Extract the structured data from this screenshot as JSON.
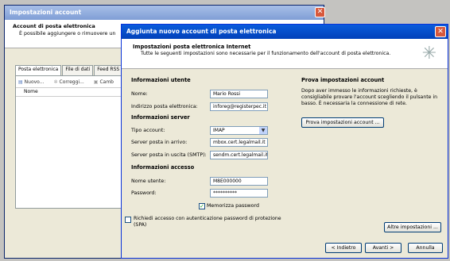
{
  "back_window": {
    "title": "Impostazioni account",
    "header_title": "Account di posta elettronica",
    "header_subtitle": "È possibile aggiungere o rimuovere un",
    "tabs": [
      "Posta elettronica",
      "File di dati",
      "Feed RSS"
    ],
    "toolbar": {
      "new": "Nuovo...",
      "repair": "Correggi...",
      "change": "Camb"
    },
    "column_name": "Nome"
  },
  "dialog": {
    "title": "Aggiunta nuovo account di posta elettronica",
    "header_title": "Impostazioni posta elettronica Internet",
    "header_subtitle": "Tutte le seguenti impostazioni sono necessarie per il funzionamento dell'account di posta elettronica.",
    "user_info": {
      "heading": "Informazioni utente",
      "name_label": "Nome:",
      "name_value": "Mario Rossi",
      "email_label": "Indirizzo posta elettronica:",
      "email_value": "inforeg@registerpec.it"
    },
    "server_info": {
      "heading": "Informazioni server",
      "type_label": "Tipo account:",
      "type_value": "IMAP",
      "incoming_label": "Server posta in arrivo:",
      "incoming_value": "mbox.cert.legalmail.it",
      "outgoing_label": "Server posta in uscita (SMTP):",
      "outgoing_value": "sendm.cert.legalmail.it"
    },
    "access_info": {
      "heading": "Informazioni accesso",
      "username_label": "Nome utente:",
      "username_value": "M8E000000",
      "password_label": "Password:",
      "password_value": "**********",
      "remember_label": "Memorizza password",
      "remember_checked": true
    },
    "spa_label": "Richiedi accesso con autenticazione password di protezione (SPA)",
    "spa_checked": false,
    "test": {
      "heading": "Prova impostazioni account",
      "description": "Dopo aver immesso le informazioni richieste, è consigliabile provare l'account scegliendo il pulsante in basso. È necessaria la connessione di rete.",
      "button": "Prova impostazioni account ..."
    },
    "more_settings": "Altre impostazioni ...",
    "back_button": "< Indietro",
    "next_button": "Avanti >",
    "cancel_button": "Annulla"
  }
}
